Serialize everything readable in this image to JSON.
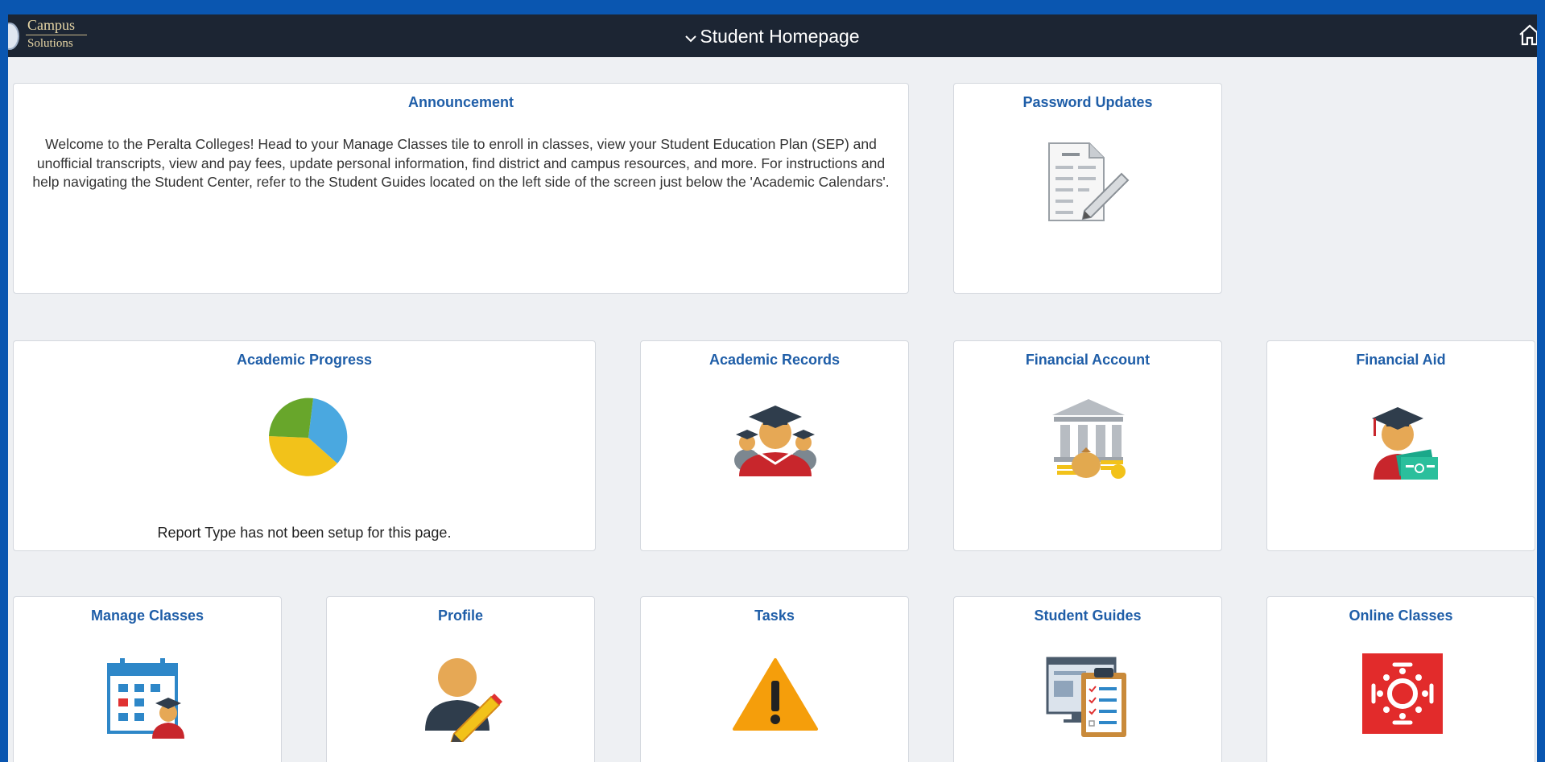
{
  "header": {
    "logo_line1": "Campus",
    "logo_line2": "Solutions",
    "title": "Student Homepage",
    "chevron_icon": "chevron-down-icon",
    "home_icon": "home-icon"
  },
  "tiles": {
    "announcement": {
      "title": "Announcement",
      "text": "Welcome to the Peralta Colleges! Head to your Manage Classes tile to enroll in classes, view your Student Education Plan (SEP) and unofficial transcripts, view and pay fees, update personal information, find district and campus resources, and more. For instructions and help navigating the Student Center, refer to the Student Guides located on the left side of the screen just below the 'Academic Calendars'."
    },
    "password_updates": {
      "title": "Password Updates",
      "icon": "document-edit-icon"
    },
    "academic_progress": {
      "title": "Academic Progress",
      "icon": "pie-chart-icon",
      "message": "Report Type has not been setup for this page."
    },
    "academic_records": {
      "title": "Academic Records",
      "icon": "graduates-icon"
    },
    "financial_account": {
      "title": "Financial Account",
      "icon": "bank-icon"
    },
    "financial_aid": {
      "title": "Financial Aid",
      "icon": "graduate-money-icon"
    },
    "manage_classes": {
      "title": "Manage Classes",
      "icon": "calendar-student-icon"
    },
    "profile": {
      "title": "Profile",
      "icon": "profile-edit-icon"
    },
    "tasks": {
      "title": "Tasks",
      "icon": "warning-icon"
    },
    "student_guides": {
      "title": "Student Guides",
      "icon": "guides-clipboard-icon"
    },
    "online_classes": {
      "title": "Online Classes",
      "icon": "canvas-logo-icon"
    }
  },
  "colors": {
    "frame_blue": "#0a56b0",
    "header_bg": "#1c2533",
    "tile_title": "#1f5ea8",
    "page_bg": "#eef0f3",
    "canvas_red": "#e22b2b"
  }
}
